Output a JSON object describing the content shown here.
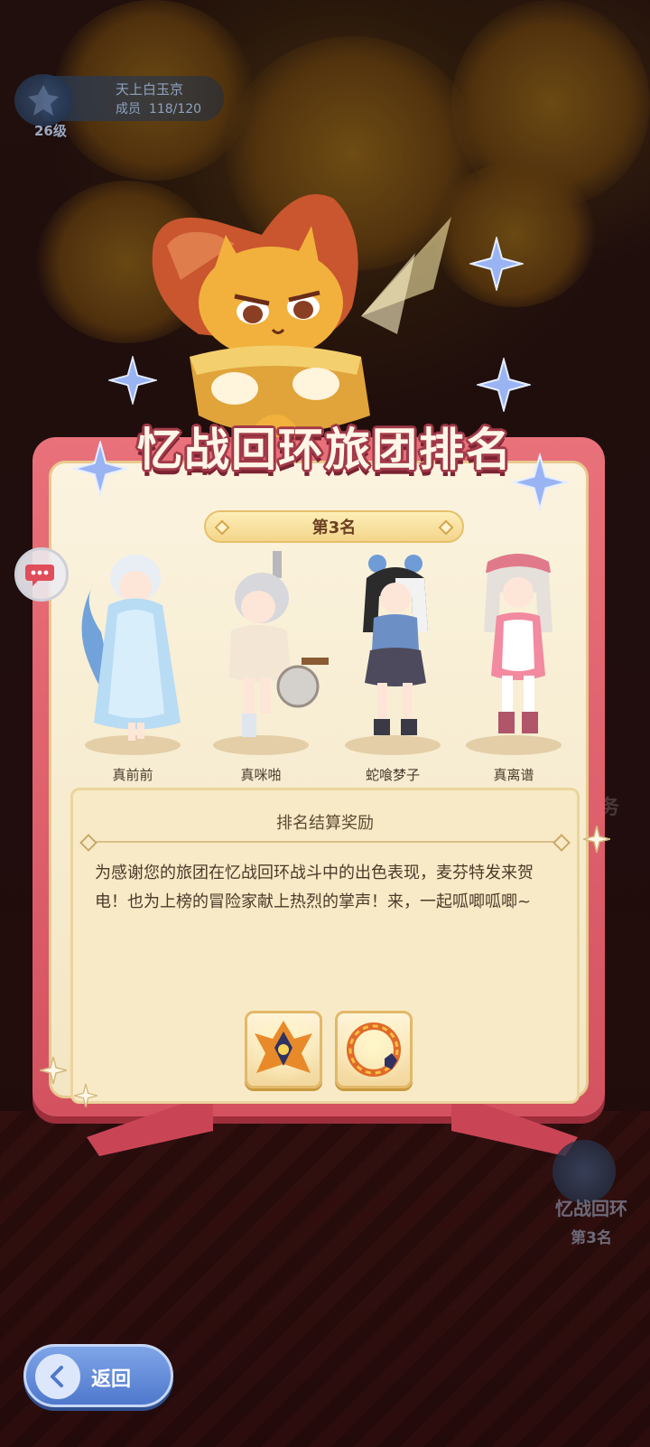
{
  "guild": {
    "name": "天上白玉京",
    "members_label": "成员",
    "members_value": "118/120",
    "level": "26级"
  },
  "panel": {
    "title": "忆战回环旅团排名",
    "rank": "第3名"
  },
  "members": [
    {
      "name": "真前前"
    },
    {
      "name": "真咪啪"
    },
    {
      "name": "蛇喰梦子"
    },
    {
      "name": "真离谱"
    }
  ],
  "reward": {
    "title": "排名结算奖励",
    "text": "为感谢您的旅团在忆战回环战斗中的出色表现，麦芬特发来贺电！也为上榜的冒险家献上热烈的掌声！来，一起呱唧呱唧~",
    "items": [
      "crest-icon",
      "avatar-frame-icon"
    ]
  },
  "side": {
    "event_name": "忆战回环",
    "event_rank": "第3名",
    "faded_1": "务"
  },
  "back_button": {
    "label": "返回"
  },
  "colors": {
    "panel_pink": "#d45260",
    "panel_cream": "#fbf3df",
    "button_blue": "#4f78cc"
  }
}
